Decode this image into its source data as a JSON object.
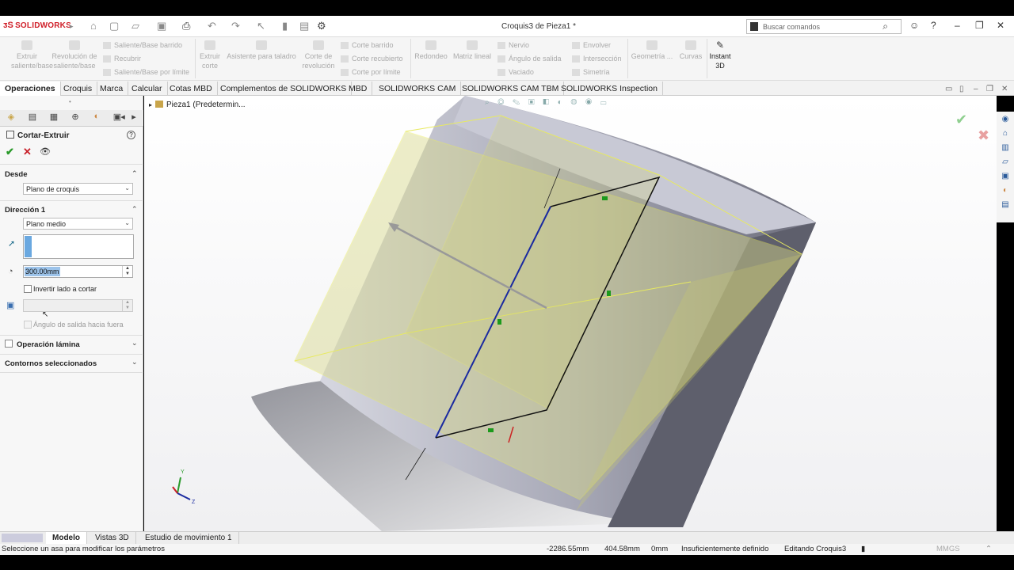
{
  "app": {
    "logo_text": "SOLIDWORKS",
    "window_title": "Croquis3 de Pieza1 *",
    "search_placeholder": "Buscar comandos"
  },
  "ribbon": {
    "extrude_boss": "Extruir saliente/base",
    "revolve_boss": "Revolución de saliente/base",
    "swept_boss": "Saliente/Base barrido",
    "loft_boss": "Recubrir",
    "boundary_boss": "Saliente/Base por límite",
    "extrude_cut": "Extruir corte",
    "hole_wizard": "Asistente para taladro",
    "revolve_cut": "Corte de revolución",
    "swept_cut": "Corte barrido",
    "loft_cut": "Corte recubierto",
    "boundary_cut": "Corte por límite",
    "fillet": "Redondeo",
    "linear_pattern": "Matriz lineal",
    "rib": "Nervio",
    "draft": "Ángulo de salida",
    "shell": "Vaciado",
    "wrap": "Envolver",
    "intersect": "Intersección",
    "mirror": "Simetría",
    "ref_geometry": "Geometría ...",
    "curves": "Curvas",
    "instant3d": "Instant 3D"
  },
  "tabs": [
    "Operaciones",
    "Croquis",
    "Marca",
    "Calcular",
    "Cotas MBD",
    "Complementos de SOLIDWORKS",
    "MBD",
    "SOLIDWORKS CAM",
    "SOLIDWORKS CAM TBM",
    "SOLIDWORKS Inspection"
  ],
  "property_manager": {
    "title": "Cortar-Extruir",
    "from_section": "Desde",
    "from_value": "Plano de croquis",
    "direction_section": "Dirección 1",
    "end_condition": "Plano medio",
    "depth_value": "300.00mm",
    "flip_side_label": "Invertir lado a cortar",
    "draft_outward_label": "Ángulo de salida hacia fuera",
    "thin_feature": "Operación lámina",
    "selected_contours": "Contornos seleccionados"
  },
  "feature_tree": {
    "root": "Pieza1  (Predetermin..."
  },
  "bottom_tabs": [
    "Modelo",
    "Vistas 3D",
    "Estudio de movimiento 1"
  ],
  "status": {
    "message": "Seleccione un asa para modificar los parámetros",
    "x": "-2286.55mm",
    "y": "404.58mm",
    "z": "0mm",
    "definition": "Insuficientemente definido",
    "editing": "Editando Croquis3",
    "units": "MMGS"
  },
  "triad": {
    "y": "Y",
    "z": "Z"
  },
  "colors": {
    "accent_red": "#d0202a",
    "preview_yellow": "#e8ea60",
    "sketch_blue": "#1a2aa0"
  }
}
